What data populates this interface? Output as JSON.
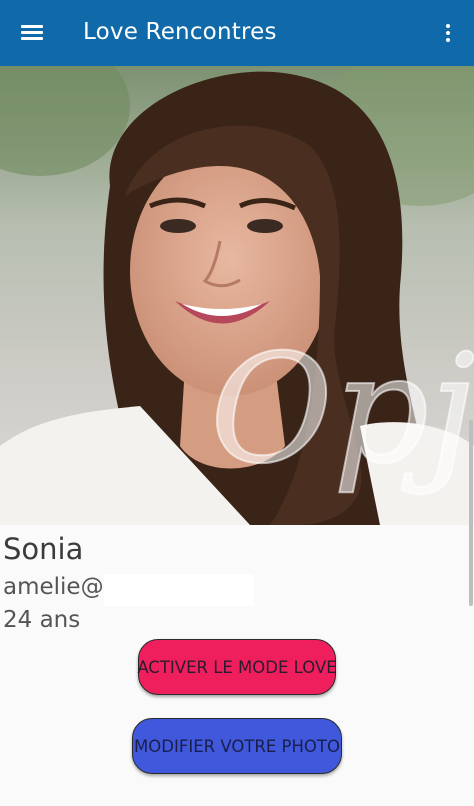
{
  "app_bar": {
    "title": "Love Rencontres",
    "menu_icon": "hamburger-menu-icon",
    "overflow_icon": "more-vert-icon",
    "background": "#1069a8"
  },
  "photo": {
    "watermark": "Opje"
  },
  "profile": {
    "name": "Sonia",
    "email": "amelie@",
    "age": "24 ans"
  },
  "buttons": {
    "love_mode": "ACTIVER LE MODE LOVE",
    "love_color": "#ee1f5c",
    "modify_photo": "MODIFIER VOTRE PHOTO",
    "photo_color": "#3f58dc"
  }
}
